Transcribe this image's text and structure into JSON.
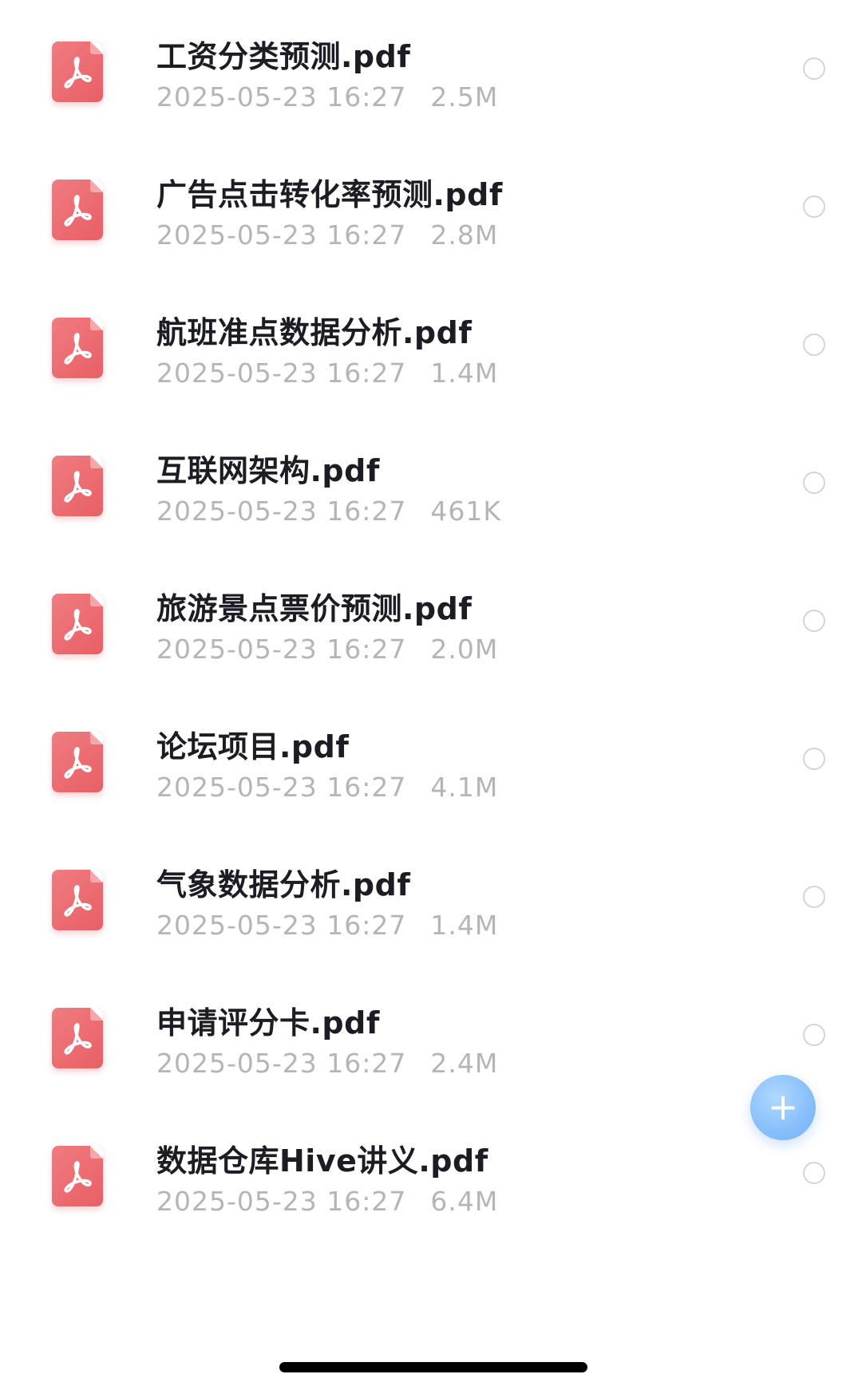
{
  "files": [
    {
      "name": "工资分类预测.pdf",
      "date": "2025-05-23 16:27",
      "size": "2.5M",
      "icon": "pdf-icon"
    },
    {
      "name": "广告点击转化率预测.pdf",
      "date": "2025-05-23 16:27",
      "size": "2.8M",
      "icon": "pdf-icon"
    },
    {
      "name": "航班准点数据分析.pdf",
      "date": "2025-05-23 16:27",
      "size": "1.4M",
      "icon": "pdf-icon"
    },
    {
      "name": "互联网架构.pdf",
      "date": "2025-05-23 16:27",
      "size": "461K",
      "icon": "pdf-icon"
    },
    {
      "name": "旅游景点票价预测.pdf",
      "date": "2025-05-23 16:27",
      "size": "2.0M",
      "icon": "pdf-icon"
    },
    {
      "name": "论坛项目.pdf",
      "date": "2025-05-23 16:27",
      "size": "4.1M",
      "icon": "pdf-icon"
    },
    {
      "name": "气象数据分析.pdf",
      "date": "2025-05-23 16:27",
      "size": "1.4M",
      "icon": "pdf-icon"
    },
    {
      "name": "申请评分卡.pdf",
      "date": "2025-05-23 16:27",
      "size": "2.4M",
      "icon": "pdf-icon"
    },
    {
      "name": "数据仓库Hive讲义.pdf",
      "date": "2025-05-23 16:27",
      "size": "6.4M",
      "icon": "pdf-icon"
    }
  ],
  "fab": {
    "icon": "plus-icon",
    "label": "+"
  },
  "colors": {
    "pdf_icon": "#ea6a70",
    "title_text": "#1c1c24",
    "meta_text": "#b3b5bb",
    "select_circle": "#d3d5da",
    "fab": "#7ab8fb"
  }
}
